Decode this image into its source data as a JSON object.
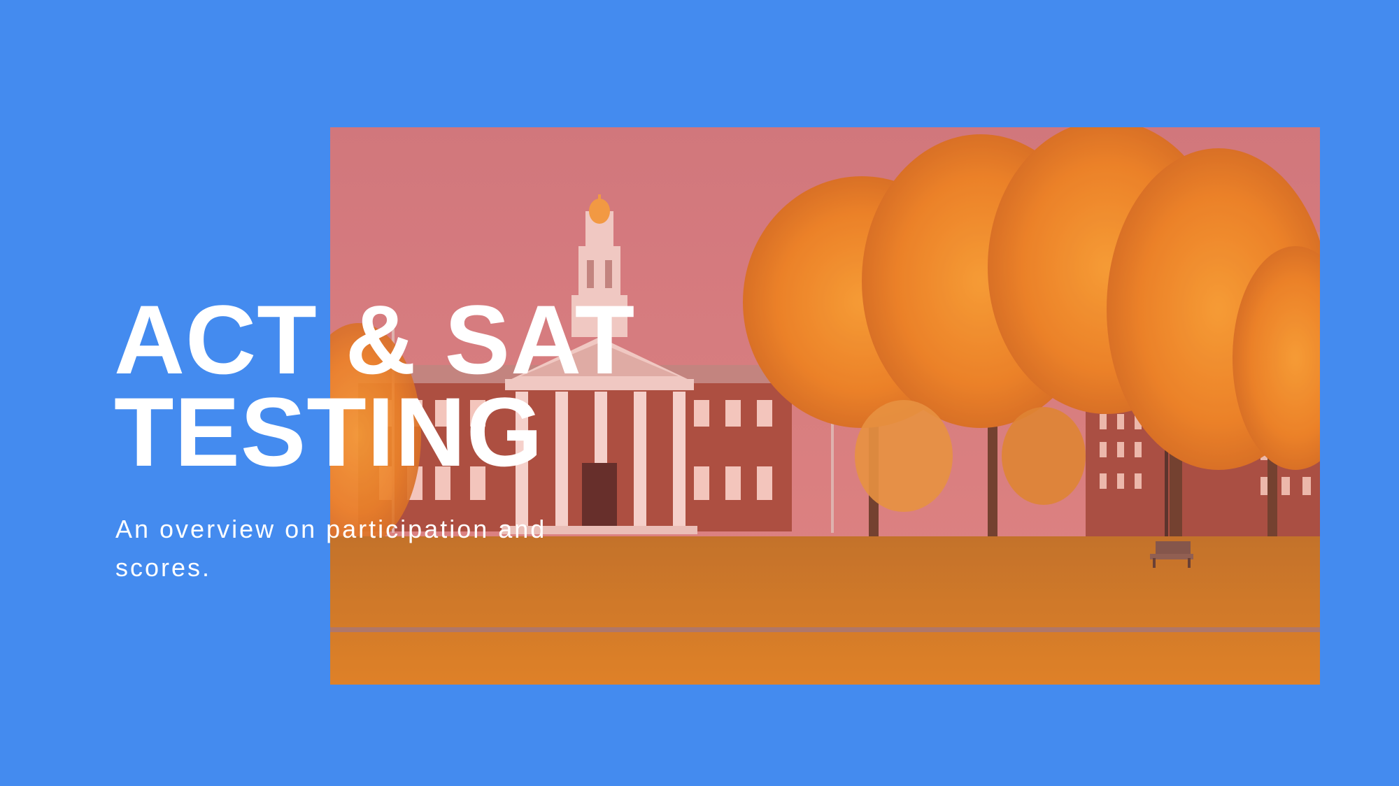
{
  "slide": {
    "title_line_1": "ACT & SAT",
    "title_line_2": "TESTING",
    "subtitle": "An overview on participation and scores."
  },
  "photo": {
    "subject": "campus-building-autumn",
    "overlay_color": "#ff6b6b"
  },
  "colors": {
    "background": "#448bef",
    "text": "#ffffff",
    "foliage": "#f08a1c",
    "brick": "#9e4a3a",
    "lawn": "#b8741e"
  }
}
